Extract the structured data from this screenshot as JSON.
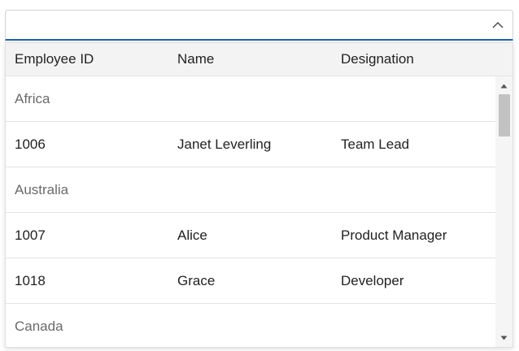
{
  "combobox": {
    "value": "",
    "placeholder": "",
    "toggle_icon": "chevron-up-icon",
    "accent_color": "#1f5fb2"
  },
  "table": {
    "columns": [
      "Employee ID",
      "Name",
      "Designation"
    ],
    "rows": [
      {
        "type": "group",
        "label": "Africa"
      },
      {
        "type": "item",
        "id": "1006",
        "name": "Janet Leverling",
        "designation": "Team Lead"
      },
      {
        "type": "group",
        "label": "Australia"
      },
      {
        "type": "item",
        "id": "1007",
        "name": "Alice",
        "designation": "Product Manager"
      },
      {
        "type": "item",
        "id": "1018",
        "name": "Grace",
        "designation": "Developer"
      },
      {
        "type": "group",
        "label": "Canada"
      }
    ]
  },
  "scrollbar": {
    "position": 0.0
  }
}
